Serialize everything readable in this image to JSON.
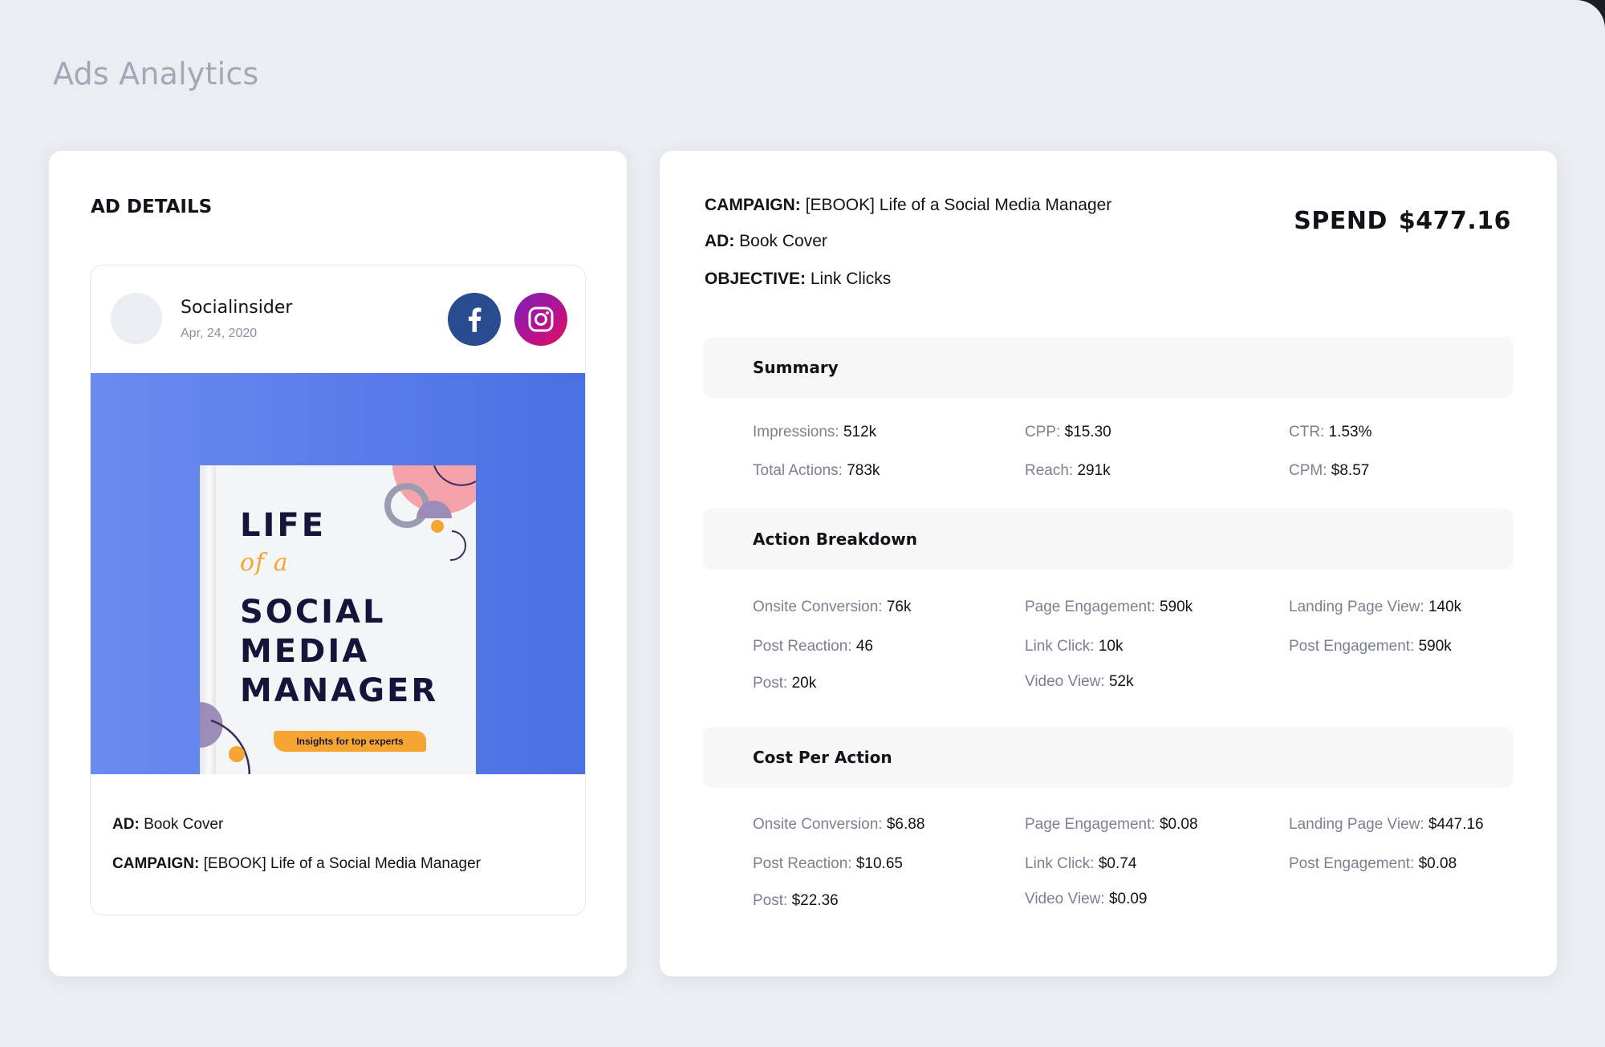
{
  "page": {
    "title": "Ads Analytics"
  },
  "ad_details": {
    "title": "AD DETAILS",
    "account_name": "Socialinsider",
    "date": "Apr, 24, 2020",
    "networks": [
      "facebook-icon",
      "instagram-icon"
    ],
    "creative": {
      "lines": [
        "LIFE",
        "of a",
        "SOCIAL",
        "MEDIA",
        "MANAGER"
      ],
      "banner": "Insights for top experts"
    },
    "ad_label": "AD:",
    "ad_value": "Book Cover",
    "campaign_label": "CAMPAIGN:",
    "campaign_value": "[EBOOK] Life of a Social Media Manager"
  },
  "overview": {
    "campaign_label": "CAMPAIGN:",
    "campaign_value": "[EBOOK] Life of a Social Media Manager",
    "ad_label": "AD:",
    "ad_value": "Book Cover",
    "objective_label": "OBJECTIVE:",
    "objective_value": "Link Clicks",
    "spend_label": "SPEND",
    "spend_value": "$477.16"
  },
  "summary": {
    "title": "Summary",
    "metrics": [
      {
        "label": "Impressions:",
        "value": "512k"
      },
      {
        "label": "CPP:",
        "value": "$15.30"
      },
      {
        "label": "CTR:",
        "value": "1.53%"
      },
      {
        "label": "Total Actions:",
        "value": "783k"
      },
      {
        "label": "Reach:",
        "value": "291k"
      },
      {
        "label": "CPM:",
        "value": "$8.57"
      }
    ]
  },
  "action_breakdown": {
    "title": "Action Breakdown",
    "metrics": [
      {
        "label": "Onsite Conversion:",
        "value": "76k"
      },
      {
        "label": "Page Engagement:",
        "value": "590k"
      },
      {
        "label": "Landing Page View:",
        "value": "140k"
      },
      {
        "label": "Post Reaction:",
        "value": "46"
      },
      {
        "label": "Link Click:",
        "value": "10k"
      },
      {
        "label": "Post Engagement:",
        "value": "590k"
      },
      {
        "label": "Post:",
        "value": "20k"
      },
      {
        "label": "Video View:",
        "value": "52k"
      }
    ]
  },
  "cost_per_action": {
    "title": "Cost Per Action",
    "metrics": [
      {
        "label": "Onsite Conversion:",
        "value": "$6.88"
      },
      {
        "label": "Page Engagement:",
        "value": "$0.08"
      },
      {
        "label": "Landing Page View:",
        "value": "$447.16"
      },
      {
        "label": "Post Reaction:",
        "value": "$10.65"
      },
      {
        "label": "Link Click:",
        "value": "$0.74"
      },
      {
        "label": "Post Engagement:",
        "value": "$0.08"
      },
      {
        "label": "Post:",
        "value": "$22.36"
      },
      {
        "label": "Video View:",
        "value": "$0.09"
      }
    ]
  },
  "colors": {
    "background": "#ebedf2",
    "card": "#ffffff",
    "facebook": "#284c8f",
    "instagram": "#b4138f",
    "ad_image": "#4b6fe4",
    "book_accent": "#f4a532"
  }
}
